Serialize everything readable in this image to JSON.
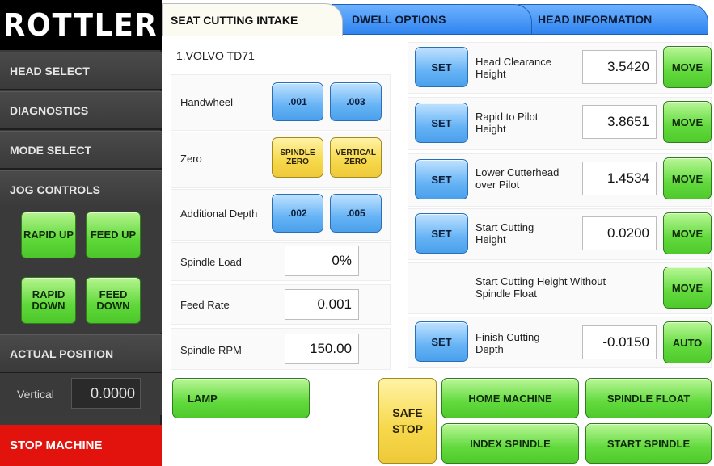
{
  "logo": "ROTTLER",
  "sidebar": {
    "head_select": "HEAD SELECT",
    "diagnostics": "DIAGNOSTICS",
    "mode_select": "MODE SELECT",
    "jog_controls": "JOG CONTROLS",
    "jog": {
      "rapid_up": "RAPID UP",
      "feed_up": "FEED UP",
      "rapid_down": "RAPID DOWN",
      "feed_down": "FEED DOWN"
    },
    "actual_position": "ACTUAL POSITION",
    "vertical_label": "Vertical",
    "vertical_value": "0.0000",
    "stop_machine": "STOP MACHINE"
  },
  "tabs": {
    "seat_cutting_intake": "SEAT CUTTING INTAKE",
    "dwell_options": "DWELL OPTIONS",
    "head_information": "HEAD INFORMATION"
  },
  "left_panel": {
    "head_name": "1.VOLVO TD71",
    "handwheel_label": "Handwheel",
    "handwheel_001": ".001",
    "handwheel_003": ".003",
    "zero_label": "Zero",
    "spindle_zero": "SPINDLE ZERO",
    "vertical_zero": "VERTICAL ZERO",
    "additional_depth_label": "Additional Depth",
    "depth_002": ".002",
    "depth_005": ".005",
    "spindle_load_label": "Spindle Load",
    "spindle_load_value": "0%",
    "feed_rate_label": "Feed Rate",
    "feed_rate_value": "0.001",
    "spindle_rpm_label": "Spindle RPM",
    "spindle_rpm_value": "150.00",
    "lamp": "LAMP"
  },
  "right_panel": {
    "set_label": "SET",
    "move_label": "MOVE",
    "auto_label": "AUTO",
    "rows": [
      {
        "name": "Head Clearance Height",
        "value": "3.5420"
      },
      {
        "name": "Rapid to Pilot Height",
        "value": "3.8651"
      },
      {
        "name": "Lower Cutterhead over Pilot",
        "value": "1.4534"
      },
      {
        "name": "Start Cutting Height",
        "value": "0.0200"
      },
      {
        "name": "Start Cutting Height Without Spindle Float",
        "value": ""
      },
      {
        "name": "Finish Cutting Depth",
        "value": "-0.0150"
      }
    ]
  },
  "bottom": {
    "safe_stop": "SAFE STOP",
    "home_machine": "HOME MACHINE",
    "spindle_float": "SPINDLE FLOAT",
    "index_spindle": "INDEX SPINDLE",
    "start_spindle": "START SPINDLE"
  },
  "colors": {
    "sidebar_bg": "#3b3b3b",
    "stop_red": "#e2120c",
    "green_button": "#62da3d",
    "blue_button": "#66b3f5",
    "yellow_button": "#f6d84a",
    "tab_blue": "#2f84f0"
  }
}
